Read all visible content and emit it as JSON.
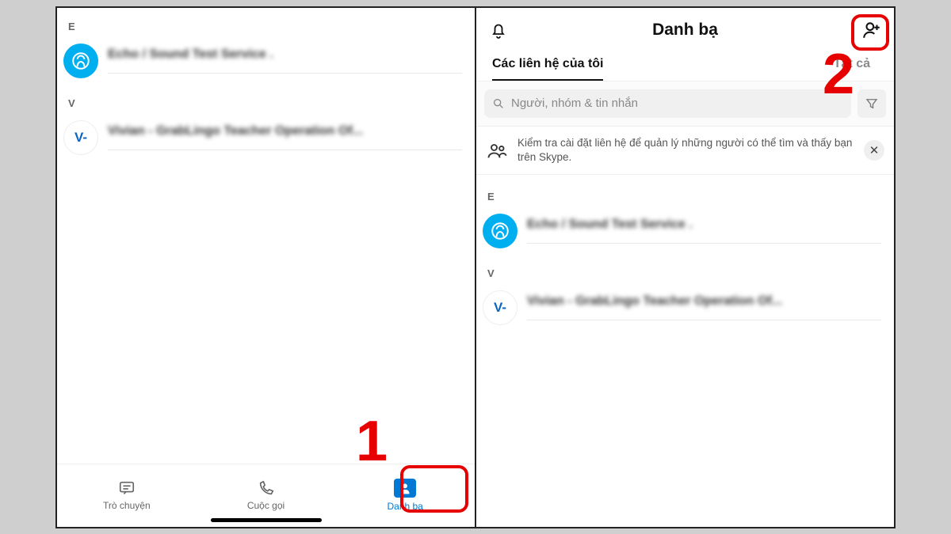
{
  "left": {
    "sections": [
      {
        "letter": "E",
        "avatar_type": "skype",
        "avatar_text": "",
        "name": "Echo / Sound Test Service ."
      },
      {
        "letter": "V",
        "avatar_type": "letter",
        "avatar_text": "V-",
        "name": "Vivian - GrabLingo Teacher Operation Of..."
      }
    ],
    "tabs": {
      "chat": "Trò chuyện",
      "calls": "Cuộc gọi",
      "contacts": "Danh bạ"
    },
    "callout_number": "1"
  },
  "right": {
    "title": "Danh bạ",
    "subtabs": {
      "mine": "Các liên hệ của tôi",
      "all": "Tất cả"
    },
    "search_placeholder": "Người, nhóm & tin nhắn",
    "notice": "Kiểm tra cài đặt liên hệ để quản lý những người có thể tìm và thấy bạn trên Skype.",
    "sections": [
      {
        "letter": "E",
        "avatar_type": "skype",
        "avatar_text": "",
        "name": "Echo / Sound Test Service ."
      },
      {
        "letter": "V",
        "avatar_type": "letter",
        "avatar_text": "V-",
        "name": "Vivian - GrabLingo Teacher Operation Of..."
      }
    ],
    "callout_number": "2"
  }
}
